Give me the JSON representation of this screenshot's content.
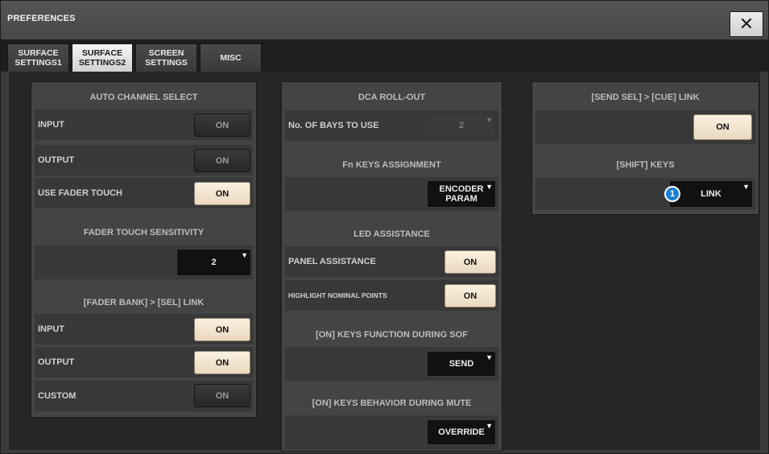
{
  "window": {
    "title": "PREFERENCES",
    "close_glyph": "✕"
  },
  "tabs": [
    {
      "label": "SURFACE\nSETTINGS1",
      "active": false
    },
    {
      "label": "SURFACE\nSETTINGS2",
      "active": true
    },
    {
      "label": "SCREEN\nSETTINGS",
      "active": false
    },
    {
      "label": "MISC",
      "active": false
    }
  ],
  "left_panel": {
    "auto_channel_select": {
      "heading": "AUTO CHANNEL SELECT",
      "rows": [
        {
          "label": "INPUT",
          "value": "ON",
          "state": "off"
        },
        {
          "label": "OUTPUT",
          "value": "ON",
          "state": "off"
        },
        {
          "label": "USE FADER TOUCH",
          "value": "ON",
          "state": "on"
        }
      ]
    },
    "fader_touch_sensitivity": {
      "heading": "FADER TOUCH SENSITIVITY",
      "value": "2"
    },
    "fader_bank_sel_link": {
      "heading": "[FADER BANK] > [SEL] LINK",
      "rows": [
        {
          "label": "INPUT",
          "value": "ON",
          "state": "on"
        },
        {
          "label": "OUTPUT",
          "value": "ON",
          "state": "on"
        },
        {
          "label": "CUSTOM",
          "value": "ON",
          "state": "off"
        }
      ]
    }
  },
  "middle_panel": {
    "dca_roll_out": {
      "heading": "DCA ROLL-OUT",
      "label": "No. OF BAYS TO USE",
      "value": "2"
    },
    "fn_keys": {
      "heading": "Fn KEYS ASSIGNMENT",
      "value": "ENCODER\nPARAM"
    },
    "led_assistance": {
      "heading": "LED ASSISTANCE",
      "rows": [
        {
          "label": "PANEL ASSISTANCE",
          "value": "ON",
          "state": "on"
        },
        {
          "label": "HIGHLIGHT NOMINAL POINTS",
          "value": "ON",
          "state": "on"
        }
      ]
    },
    "on_keys_sof": {
      "heading": "[ON] KEYS FUNCTION DURING SOF",
      "value": "SEND"
    },
    "on_keys_mute": {
      "heading": "[ON] KEYS BEHAVIOR DURING MUTE",
      "value": "OVERRIDE"
    }
  },
  "right_panel": {
    "send_sel_cue": {
      "heading": "[SEND SEL] > [CUE] LINK",
      "value": "ON",
      "state": "on"
    },
    "shift_keys": {
      "heading": "[SHIFT] KEYS",
      "value": "LINK"
    },
    "callout": "1"
  },
  "colors": {
    "on_button": "#f5ead6",
    "accent_badge": "#1c7fd6"
  },
  "icons": {
    "close": "close-icon",
    "dropdown": "caret-down-icon"
  }
}
